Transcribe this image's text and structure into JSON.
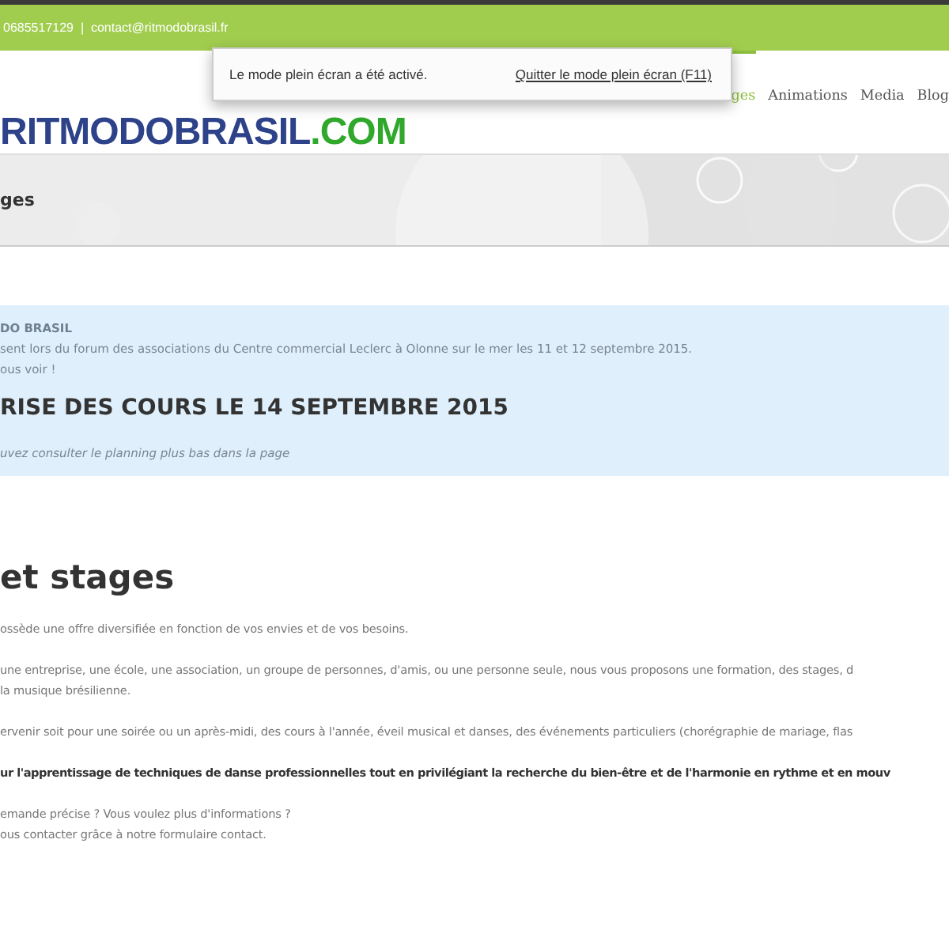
{
  "topbar": {
    "contact": "0685517129  |  contact@ritmodobrasil.fr"
  },
  "logo": {
    "main": "RITMODOBRASIL",
    "suffix": ".COM"
  },
  "nav": [
    {
      "label": "ges",
      "selected": true
    },
    {
      "label": "Animations",
      "selected": false
    },
    {
      "label": "Media",
      "selected": false
    },
    {
      "label": "Blog",
      "selected": false
    }
  ],
  "banner": {
    "title": "ges"
  },
  "notice": {
    "heading": "DO BRASIL",
    "lines": [
      "sent lors du forum des associations du Centre commercial Leclerc à Olonne sur le mer les 11 et 12 septembre 2015.",
      "ous voir !"
    ],
    "title": "RISE DES COURS LE 14 SEPTEMBRE 2015",
    "note": "uvez consulter le planning plus bas dans la page"
  },
  "content": {
    "title": "et stages",
    "paragraphs": [
      {
        "lines": [
          "ossède une offre diversifiée en fonction de vos envies et de vos besoins."
        ],
        "bold": false
      },
      {
        "lines": [
          "une entreprise, une école, une association, un groupe de personnes, d'amis, ou une personne seule, nous vous proposons une formation, des stages, d",
          "la musique brésilienne."
        ],
        "bold": false
      },
      {
        "lines": [
          "ervenir soit pour une soirée ou un après-midi, des cours à l'année, éveil musical et danses, des événements particuliers (chorégraphie de mariage, flas"
        ],
        "bold": false
      },
      {
        "lines": [
          "ur l'apprentissage de techniques de danse professionnelles tout en privilégiant la recherche du bien-être et de l'harmonie en rythme et en mouv"
        ],
        "bold": true
      },
      {
        "lines": [
          "emande précise ? Vous voulez plus d'informations ?",
          "ous contacter grâce à notre formulaire contact."
        ],
        "bold": false
      }
    ]
  },
  "popup": {
    "message": "Le mode plein écran a été activé.",
    "link": "Quitter le mode plein écran (F11)"
  }
}
